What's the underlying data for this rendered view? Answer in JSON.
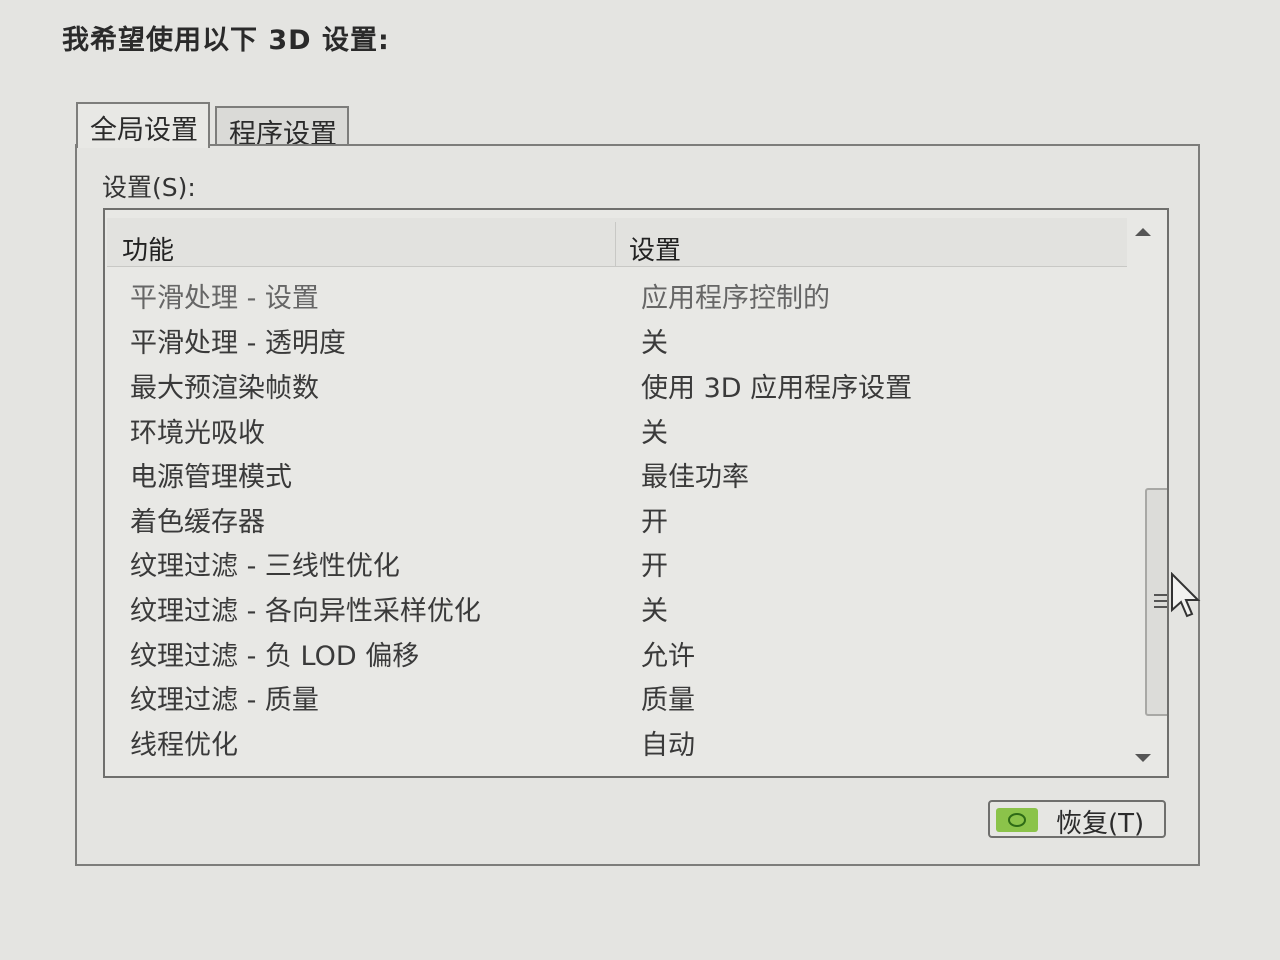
{
  "heading": "我希望使用以下 3D 设置:",
  "tabs": [
    {
      "label": "全局设置",
      "active": true
    },
    {
      "label": "程序设置",
      "active": false
    }
  ],
  "settings_label": "设置(S):",
  "table": {
    "columns": [
      "功能",
      "设置"
    ],
    "rows": [
      {
        "feature": "平滑处理 - 设置",
        "value": "应用程序控制的"
      },
      {
        "feature": "平滑处理 - 透明度",
        "value": "关"
      },
      {
        "feature": "最大预渲染帧数",
        "value": "使用 3D 应用程序设置"
      },
      {
        "feature": "环境光吸收",
        "value": "关"
      },
      {
        "feature": "电源管理模式",
        "value": "最佳功率"
      },
      {
        "feature": "着色缓存器",
        "value": "开"
      },
      {
        "feature": "纹理过滤 - 三线性优化",
        "value": "开"
      },
      {
        "feature": "纹理过滤 - 各向异性采样优化",
        "value": "关"
      },
      {
        "feature": "纹理过滤 - 负 LOD 偏移",
        "value": "允许"
      },
      {
        "feature": "纹理过滤 - 质量",
        "value": "质量"
      },
      {
        "feature": "线程优化",
        "value": "自动"
      }
    ]
  },
  "restore_button": {
    "label": "恢复(T)",
    "icon": "nvidia-logo-icon",
    "logo_color": "#8bc34a"
  }
}
